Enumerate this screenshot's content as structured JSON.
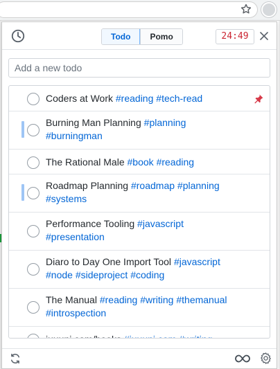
{
  "browser": {
    "star_icon": "bookmark-star-icon",
    "extension_icon": "extension-icon"
  },
  "header": {
    "history_icon": "history-clock-icon",
    "tabs": [
      {
        "label": "Todo",
        "active": true
      },
      {
        "label": "Pomo",
        "active": false
      }
    ],
    "timer": "24:49",
    "close_icon": "close-icon"
  },
  "new_todo": {
    "placeholder": "Add a new todo",
    "value": ""
  },
  "todos": [
    {
      "title": "Coders at Work",
      "tags": [
        "#reading",
        "#tech-read"
      ],
      "pinned": true,
      "marked": false
    },
    {
      "title": "Burning Man Planning",
      "tags": [
        "#planning",
        "#burningman"
      ],
      "pinned": false,
      "marked": true
    },
    {
      "title": "The Rational Male",
      "tags": [
        "#book",
        "#reading"
      ],
      "pinned": false,
      "marked": false
    },
    {
      "title": "Roadmap Planning",
      "tags": [
        "#roadmap",
        "#planning",
        "#systems"
      ],
      "pinned": false,
      "marked": true
    },
    {
      "title": "Performance Tooling",
      "tags": [
        "#javascript",
        "#presentation"
      ],
      "pinned": false,
      "marked": false
    },
    {
      "title": "Diaro to Day One Import Tool",
      "tags": [
        "#javascript",
        "#node",
        "#sideproject",
        "#coding"
      ],
      "pinned": false,
      "marked": false
    },
    {
      "title": "The Manual",
      "tags": [
        "#reading",
        "#writing",
        "#themanual",
        "#introspection"
      ],
      "pinned": false,
      "marked": false
    },
    {
      "title": "juuuni.com/books",
      "tags": [
        "#juuuni.com",
        "#writing"
      ],
      "pinned": false,
      "marked": false
    }
  ],
  "footer": {
    "refresh_icon": "refresh-icon",
    "infinity_icon": "infinity-icon",
    "settings_icon": "gear-icon"
  },
  "colors": {
    "accent": "#0366d6",
    "timer": "#cb2431",
    "pin": "#d73a49",
    "marker": "#9ec5f5"
  }
}
